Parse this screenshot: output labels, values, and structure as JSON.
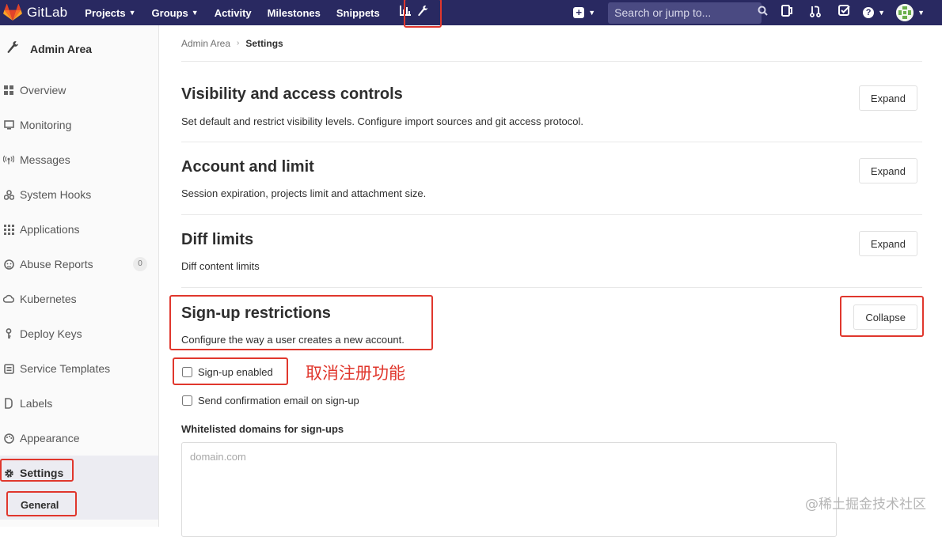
{
  "navbar": {
    "brand": "GitLab",
    "links": [
      "Projects",
      "Groups",
      "Activity",
      "Milestones",
      "Snippets"
    ],
    "search_placeholder": "Search or jump to..."
  },
  "sidebar": {
    "title": "Admin Area",
    "items": [
      {
        "label": "Overview",
        "icon": "grid-icon"
      },
      {
        "label": "Monitoring",
        "icon": "monitor-icon"
      },
      {
        "label": "Messages",
        "icon": "broadcast-icon"
      },
      {
        "label": "System Hooks",
        "icon": "hook-icon"
      },
      {
        "label": "Applications",
        "icon": "apps-icon"
      },
      {
        "label": "Abuse Reports",
        "icon": "abuse-icon",
        "count": "0"
      },
      {
        "label": "Kubernetes",
        "icon": "cloud-icon"
      },
      {
        "label": "Deploy Keys",
        "icon": "key-icon"
      },
      {
        "label": "Service Templates",
        "icon": "template-icon"
      },
      {
        "label": "Labels",
        "icon": "label-icon"
      },
      {
        "label": "Appearance",
        "icon": "palette-icon"
      },
      {
        "label": "Settings",
        "icon": "gear-icon"
      }
    ],
    "sub_item": "General"
  },
  "breadcrumb": {
    "parent": "Admin Area",
    "current": "Settings"
  },
  "sections": [
    {
      "title": "Visibility and access controls",
      "desc": "Set default and restrict visibility levels. Configure import sources and git access protocol.",
      "button": "Expand"
    },
    {
      "title": "Account and limit",
      "desc": "Session expiration, projects limit and attachment size.",
      "button": "Expand"
    },
    {
      "title": "Diff limits",
      "desc": "Diff content limits",
      "button": "Expand"
    },
    {
      "title": "Sign-up restrictions",
      "desc": "Configure the way a user creates a new account.",
      "button": "Collapse"
    }
  ],
  "signup": {
    "enabled_label": "Sign-up enabled",
    "enabled_checked": false,
    "confirm_label": "Send confirmation email on sign-up",
    "confirm_checked": false,
    "whitelist_label": "Whitelisted domains for sign-ups",
    "whitelist_placeholder": "domain.com"
  },
  "annotation": "取消注册功能",
  "watermark": "@稀土掘金技术社区",
  "colors": {
    "navbar": "#292961",
    "highlight": "#e0372d"
  }
}
